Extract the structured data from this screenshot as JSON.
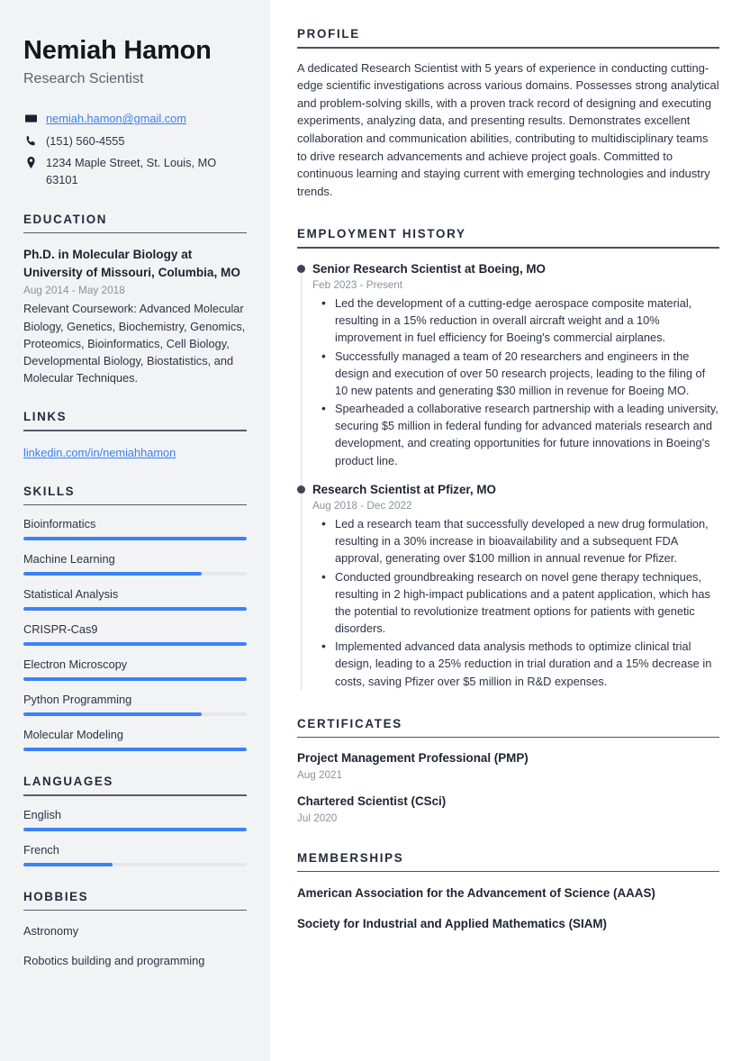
{
  "sidebar": {
    "name": "Nemiah Hamon",
    "role": "Research Scientist",
    "contact": {
      "email": "nemiah.hamon@gmail.com",
      "phone": "(151) 560-4555",
      "address": "1234 Maple Street, St. Louis, MO 63101"
    },
    "education": {
      "heading": "EDUCATION",
      "items": [
        {
          "title": "Ph.D. in Molecular Biology at University of Missouri, Columbia, MO",
          "date": "Aug 2014 - May 2018",
          "description": "Relevant Coursework: Advanced Molecular Biology, Genetics, Biochemistry, Genomics, Proteomics, Bioinformatics, Cell Biology, Developmental Biology, Biostatistics, and Molecular Techniques."
        }
      ]
    },
    "links": {
      "heading": "LINKS",
      "items": [
        {
          "label": "linkedin.com/in/nemiahhamon"
        }
      ]
    },
    "skills": {
      "heading": "SKILLS",
      "items": [
        {
          "label": "Bioinformatics",
          "level": 100
        },
        {
          "label": "Machine Learning",
          "level": 80
        },
        {
          "label": "Statistical Analysis",
          "level": 100
        },
        {
          "label": "CRISPR-Cas9",
          "level": 100
        },
        {
          "label": "Electron Microscopy",
          "level": 100
        },
        {
          "label": "Python Programming",
          "level": 80
        },
        {
          "label": "Molecular Modeling",
          "level": 100
        }
      ]
    },
    "languages": {
      "heading": "LANGUAGES",
      "items": [
        {
          "label": "English",
          "level": 100
        },
        {
          "label": "French",
          "level": 40
        }
      ]
    },
    "hobbies": {
      "heading": "HOBBIES",
      "items": [
        {
          "label": "Astronomy"
        },
        {
          "label": "Robotics building and programming"
        }
      ]
    }
  },
  "main": {
    "profile": {
      "heading": "PROFILE",
      "text": "A dedicated Research Scientist with 5 years of experience in conducting cutting-edge scientific investigations across various domains. Possesses strong analytical and problem-solving skills, with a proven track record of designing and executing experiments, analyzing data, and presenting results. Demonstrates excellent collaboration and communication abilities, contributing to multidisciplinary teams to drive research advancements and achieve project goals. Committed to continuous learning and staying current with emerging technologies and industry trends."
    },
    "employment": {
      "heading": "EMPLOYMENT HISTORY",
      "jobs": [
        {
          "title": "Senior Research Scientist at Boeing, MO",
          "date": "Feb 2023 - Present",
          "bullets": [
            "Led the development of a cutting-edge aerospace composite material, resulting in a 15% reduction in overall aircraft weight and a 10% improvement in fuel efficiency for Boeing's commercial airplanes.",
            "Successfully managed a team of 20 researchers and engineers in the design and execution of over 50 research projects, leading to the filing of 10 new patents and generating $30 million in revenue for Boeing MO.",
            "Spearheaded a collaborative research partnership with a leading university, securing $5 million in federal funding for advanced materials research and development, and creating opportunities for future innovations in Boeing's product line."
          ]
        },
        {
          "title": "Research Scientist at Pfizer, MO",
          "date": "Aug 2018 - Dec 2022",
          "bullets": [
            "Led a research team that successfully developed a new drug formulation, resulting in a 30% increase in bioavailability and a subsequent FDA approval, generating over $100 million in annual revenue for Pfizer.",
            "Conducted groundbreaking research on novel gene therapy techniques, resulting in 2 high-impact publications and a patent application, which has the potential to revolutionize treatment options for patients with genetic disorders.",
            "Implemented advanced data analysis methods to optimize clinical trial design, leading to a 25% reduction in trial duration and a 15% decrease in costs, saving Pfizer over $5 million in R&D expenses."
          ]
        }
      ]
    },
    "certificates": {
      "heading": "CERTIFICATES",
      "items": [
        {
          "name": "Project Management Professional (PMP)",
          "date": "Aug 2021"
        },
        {
          "name": "Chartered Scientist (CSci)",
          "date": "Jul 2020"
        }
      ]
    },
    "memberships": {
      "heading": "MEMBERSHIPS",
      "items": [
        {
          "name": "American Association for the Advancement of Science (AAAS)"
        },
        {
          "name": "Society for Industrial and Applied Mathematics (SIAM)"
        }
      ]
    }
  },
  "colors": {
    "accent_blue": "#3b82f6",
    "link_blue": "#3b7ff0",
    "sidebar_bg": "#f2f3f5",
    "heading": "#232b3b",
    "muted": "#8b919b"
  }
}
